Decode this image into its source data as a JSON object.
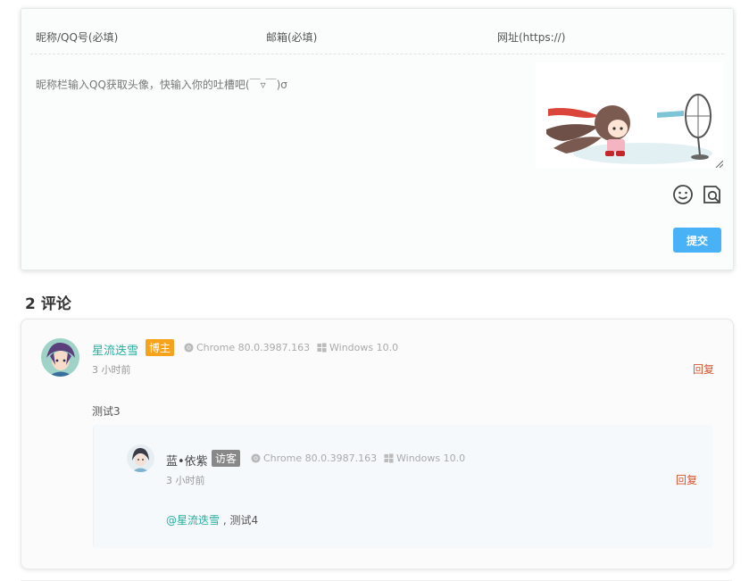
{
  "form": {
    "nick_label": "昵称/QQ号(必填)",
    "email_label": "邮箱(必填)",
    "url_label": "网址(https://)",
    "textarea_placeholder": "昵称栏输入QQ获取头像，快输入你的吐槽吧(￣▿￣)σ",
    "submit_label": "提交"
  },
  "comments_header": {
    "count": "2",
    "label": "评论"
  },
  "comments": [
    {
      "nick": "星流迭雪",
      "badge": "博主",
      "browser": "Chrome 80.0.3987.163",
      "os": "Windows 10.0",
      "time": "3 小时前",
      "reply_label": "回复",
      "content": "测试3",
      "replies": [
        {
          "nick": "蓝•依紫",
          "badge": "访客",
          "browser": "Chrome 80.0.3987.163",
          "os": "Windows 10.0",
          "time": "3 小时前",
          "reply_label": "回复",
          "mention": "@星流迭雪",
          "content": " , 测试4"
        }
      ]
    }
  ],
  "colors": {
    "accent": "#49b1f5",
    "nick_admin": "#26b0a0",
    "badge_admin": "#f7a21b",
    "badge_guest": "#888888",
    "reply": "#d9542d"
  }
}
